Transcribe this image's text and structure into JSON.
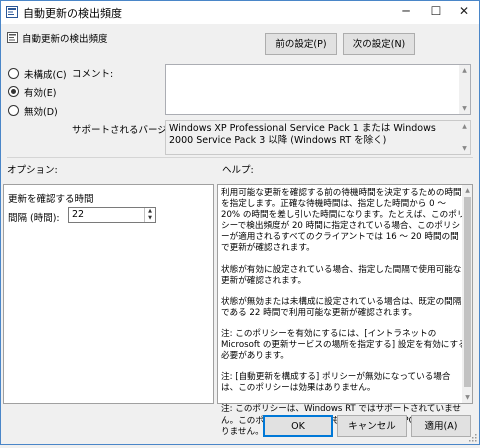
{
  "window": {
    "title": "自動更新の検出頻度",
    "minimize": "─",
    "maximize": "☐",
    "close": "✕"
  },
  "header": {
    "setting_name": "自動更新の検出頻度",
    "prev_button": "前の設定(P)",
    "next_button": "次の設定(N)"
  },
  "state": {
    "options": [
      {
        "label": "未構成(C)",
        "selected": false
      },
      {
        "label": "有効(E)",
        "selected": true
      },
      {
        "label": "無効(D)",
        "selected": false
      }
    ]
  },
  "comment": {
    "label": "コメント:",
    "value": ""
  },
  "supported": {
    "label": "サポートされるバージョン:",
    "value": "Windows XP Professional Service Pack 1 または Windows 2000 Service Pack 3 以降 (Windows RT を除く)"
  },
  "options_section": {
    "label": "オプション:",
    "group_title": "更新を確認する時間",
    "interval_label": "間隔 (時間):",
    "interval_value": "22"
  },
  "help_section": {
    "label": "ヘルプ:",
    "paragraphs": [
      "利用可能な更新を確認する前の待機時間を決定するための時間を指定します。正確な待機時間は、指定した時間から 0 ～ 20% の時間を差し引いた時間になります。たとえば、このポリシーで検出頻度が 20 時間に指定されている場合、このポリシーが適用されるすべてのクライアントでは 16 ～ 20 時間の間で更新が確認されます。",
      "状態が有効に設定されている場合、指定した間隔で使用可能な更新が確認されます。",
      "状態が無効または未構成に設定されている場合は、既定の間隔である 22 時間で利用可能な更新が確認されます。",
      "注: このポリシーを有効にするには、[イントラネットの Microsoft の更新サービスの場所を指定する] 設定を有効にする必要があります。",
      "注: [自動更新を構成する] ポリシーが無効になっている場合は、このポリシーは効果はありません。",
      "注: このポリシーは、Windows RT ではサポートされていません。このポリシーを設定しても、Windows RT PC に影響はありません。"
    ]
  },
  "footer": {
    "ok": "OK",
    "cancel": "キャンセル",
    "apply": "適用(A)"
  }
}
